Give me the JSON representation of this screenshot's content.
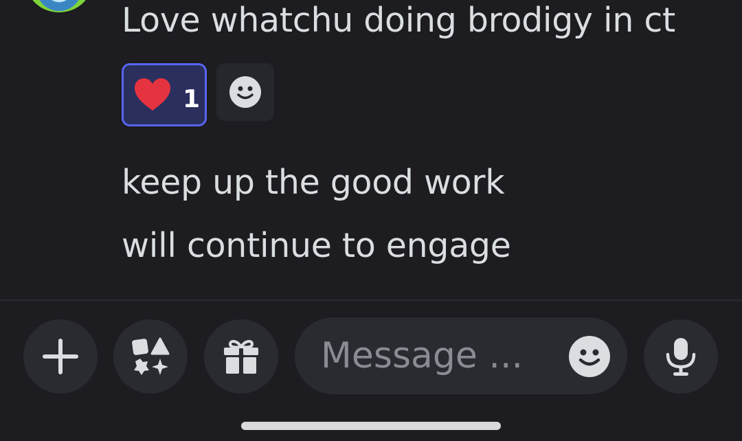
{
  "messages": [
    {
      "text": "Love whatchu doing brodigy in ct"
    },
    {
      "text": "keep up the good work"
    },
    {
      "text": "will continue to engage"
    }
  ],
  "reaction": {
    "emoji_icon": "heart-icon",
    "count": "1",
    "active_color": "#5865f2"
  },
  "add_reaction_icon": "smiley-icon",
  "composer": {
    "placeholder": "Message ...",
    "buttons": [
      "plus-icon",
      "apps-icon",
      "gift-icon",
      "microphone-icon"
    ],
    "emoji_icon": "smiley-icon"
  },
  "colors": {
    "background": "#1c1c21",
    "text": "#dbdee1",
    "control": "#2a2b31",
    "heart": "#e5333f"
  }
}
